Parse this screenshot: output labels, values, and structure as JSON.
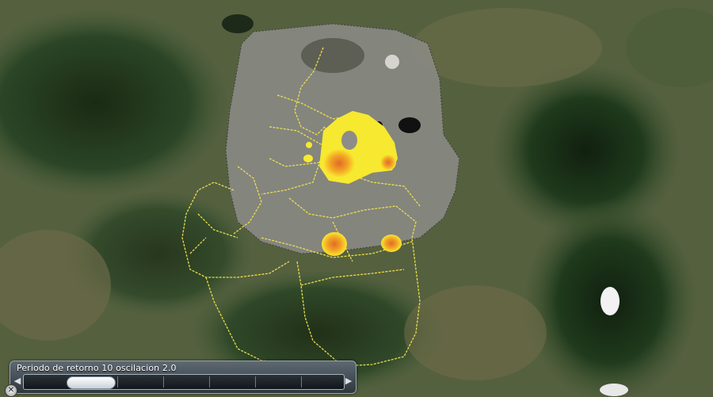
{
  "map": {
    "basemap": "satellite imagery",
    "boundary_color": "#f4e44a",
    "hotspot_colors": [
      "#f7e830",
      "#f5b020",
      "#e8782c"
    ]
  },
  "time_slider": {
    "label": "Periodo de retorno 10 oscilacion 2.0",
    "left_arrow_icon": "chevron-left-icon",
    "right_arrow_icon": "chevron-right-icon"
  },
  "close_icon": "close-icon",
  "close_symbol": "✕"
}
